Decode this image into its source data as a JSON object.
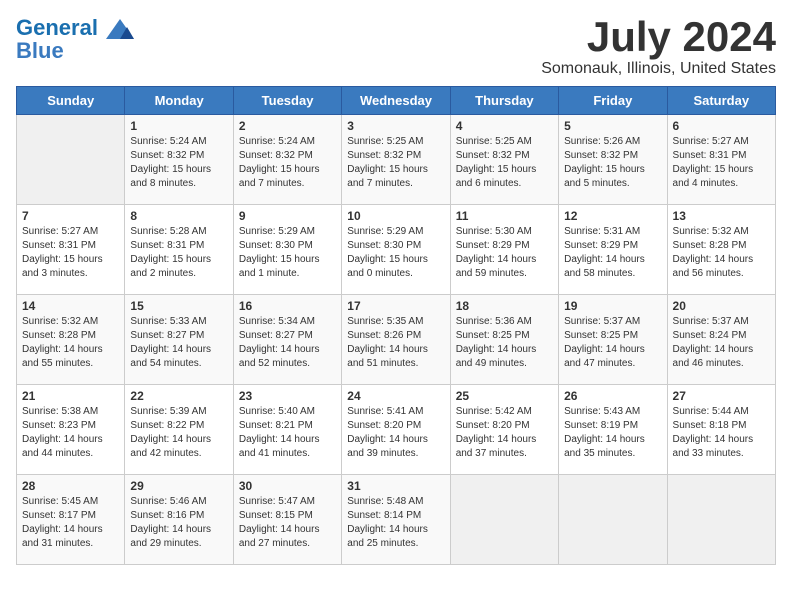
{
  "header": {
    "logo_line1": "General",
    "logo_line2": "Blue",
    "month": "July 2024",
    "location": "Somonauk, Illinois, United States"
  },
  "weekdays": [
    "Sunday",
    "Monday",
    "Tuesday",
    "Wednesday",
    "Thursday",
    "Friday",
    "Saturday"
  ],
  "weeks": [
    [
      {
        "day": "",
        "info": ""
      },
      {
        "day": "1",
        "info": "Sunrise: 5:24 AM\nSunset: 8:32 PM\nDaylight: 15 hours\nand 8 minutes."
      },
      {
        "day": "2",
        "info": "Sunrise: 5:24 AM\nSunset: 8:32 PM\nDaylight: 15 hours\nand 7 minutes."
      },
      {
        "day": "3",
        "info": "Sunrise: 5:25 AM\nSunset: 8:32 PM\nDaylight: 15 hours\nand 7 minutes."
      },
      {
        "day": "4",
        "info": "Sunrise: 5:25 AM\nSunset: 8:32 PM\nDaylight: 15 hours\nand 6 minutes."
      },
      {
        "day": "5",
        "info": "Sunrise: 5:26 AM\nSunset: 8:32 PM\nDaylight: 15 hours\nand 5 minutes."
      },
      {
        "day": "6",
        "info": "Sunrise: 5:27 AM\nSunset: 8:31 PM\nDaylight: 15 hours\nand 4 minutes."
      }
    ],
    [
      {
        "day": "7",
        "info": "Sunrise: 5:27 AM\nSunset: 8:31 PM\nDaylight: 15 hours\nand 3 minutes."
      },
      {
        "day": "8",
        "info": "Sunrise: 5:28 AM\nSunset: 8:31 PM\nDaylight: 15 hours\nand 2 minutes."
      },
      {
        "day": "9",
        "info": "Sunrise: 5:29 AM\nSunset: 8:30 PM\nDaylight: 15 hours\nand 1 minute."
      },
      {
        "day": "10",
        "info": "Sunrise: 5:29 AM\nSunset: 8:30 PM\nDaylight: 15 hours\nand 0 minutes."
      },
      {
        "day": "11",
        "info": "Sunrise: 5:30 AM\nSunset: 8:29 PM\nDaylight: 14 hours\nand 59 minutes."
      },
      {
        "day": "12",
        "info": "Sunrise: 5:31 AM\nSunset: 8:29 PM\nDaylight: 14 hours\nand 58 minutes."
      },
      {
        "day": "13",
        "info": "Sunrise: 5:32 AM\nSunset: 8:28 PM\nDaylight: 14 hours\nand 56 minutes."
      }
    ],
    [
      {
        "day": "14",
        "info": "Sunrise: 5:32 AM\nSunset: 8:28 PM\nDaylight: 14 hours\nand 55 minutes."
      },
      {
        "day": "15",
        "info": "Sunrise: 5:33 AM\nSunset: 8:27 PM\nDaylight: 14 hours\nand 54 minutes."
      },
      {
        "day": "16",
        "info": "Sunrise: 5:34 AM\nSunset: 8:27 PM\nDaylight: 14 hours\nand 52 minutes."
      },
      {
        "day": "17",
        "info": "Sunrise: 5:35 AM\nSunset: 8:26 PM\nDaylight: 14 hours\nand 51 minutes."
      },
      {
        "day": "18",
        "info": "Sunrise: 5:36 AM\nSunset: 8:25 PM\nDaylight: 14 hours\nand 49 minutes."
      },
      {
        "day": "19",
        "info": "Sunrise: 5:37 AM\nSunset: 8:25 PM\nDaylight: 14 hours\nand 47 minutes."
      },
      {
        "day": "20",
        "info": "Sunrise: 5:37 AM\nSunset: 8:24 PM\nDaylight: 14 hours\nand 46 minutes."
      }
    ],
    [
      {
        "day": "21",
        "info": "Sunrise: 5:38 AM\nSunset: 8:23 PM\nDaylight: 14 hours\nand 44 minutes."
      },
      {
        "day": "22",
        "info": "Sunrise: 5:39 AM\nSunset: 8:22 PM\nDaylight: 14 hours\nand 42 minutes."
      },
      {
        "day": "23",
        "info": "Sunrise: 5:40 AM\nSunset: 8:21 PM\nDaylight: 14 hours\nand 41 minutes."
      },
      {
        "day": "24",
        "info": "Sunrise: 5:41 AM\nSunset: 8:20 PM\nDaylight: 14 hours\nand 39 minutes."
      },
      {
        "day": "25",
        "info": "Sunrise: 5:42 AM\nSunset: 8:20 PM\nDaylight: 14 hours\nand 37 minutes."
      },
      {
        "day": "26",
        "info": "Sunrise: 5:43 AM\nSunset: 8:19 PM\nDaylight: 14 hours\nand 35 minutes."
      },
      {
        "day": "27",
        "info": "Sunrise: 5:44 AM\nSunset: 8:18 PM\nDaylight: 14 hours\nand 33 minutes."
      }
    ],
    [
      {
        "day": "28",
        "info": "Sunrise: 5:45 AM\nSunset: 8:17 PM\nDaylight: 14 hours\nand 31 minutes."
      },
      {
        "day": "29",
        "info": "Sunrise: 5:46 AM\nSunset: 8:16 PM\nDaylight: 14 hours\nand 29 minutes."
      },
      {
        "day": "30",
        "info": "Sunrise: 5:47 AM\nSunset: 8:15 PM\nDaylight: 14 hours\nand 27 minutes."
      },
      {
        "day": "31",
        "info": "Sunrise: 5:48 AM\nSunset: 8:14 PM\nDaylight: 14 hours\nand 25 minutes."
      },
      {
        "day": "",
        "info": ""
      },
      {
        "day": "",
        "info": ""
      },
      {
        "day": "",
        "info": ""
      }
    ]
  ]
}
